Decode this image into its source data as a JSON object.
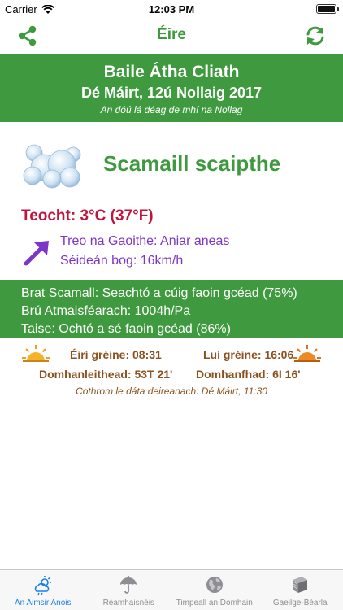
{
  "status_bar": {
    "carrier": "Carrier",
    "time": "12:03 PM"
  },
  "nav": {
    "title": "Éire",
    "share_icon": "share-icon",
    "refresh_icon": "refresh-icon"
  },
  "header": {
    "city": "Baile Átha Cliath",
    "date": "Dé Máirt, 12ú Nollaig 2017",
    "subtitle": "An dóú lá déag de mhí na Nollag"
  },
  "weather": {
    "condition": "Scamaill scaipthe",
    "temperature": "Teocht: 3°C (37°F)",
    "wind_direction": "Treo na Gaoithe: Aniar aneas",
    "wind_speed": "Séideán bog: 16km/h"
  },
  "details": {
    "cloud_cover": "Brat Scamall: Seachtó a cúig faoin gcéad (75%)",
    "pressure": "Brú Atmaisféarach: 1004h/Pa",
    "humidity": "Taise: Ochtó a sé faoin gcéad (86%)"
  },
  "sun": {
    "sunrise": "Éirí gréine: 08:31",
    "sunset": "Luí gréine: 16:06",
    "latitude": "Domhanleithead: 53T 21'",
    "longitude": "Domhanfhad: 6I 16'",
    "updated": "Cothrom le dáta deireanach: Dé Máirt, 11:30"
  },
  "tabs": [
    {
      "label": "An Aimsir Anois",
      "icon": "weather-now-icon",
      "active": true
    },
    {
      "label": "Réamhaisnéis",
      "icon": "umbrella-icon",
      "active": false
    },
    {
      "label": "Timpeall an Domhain",
      "icon": "globe-icon",
      "active": false
    },
    {
      "label": "Gaeilge-Béarla",
      "icon": "book-icon",
      "active": false
    }
  ],
  "colors": {
    "accent_green": "#3f9a3f",
    "temperature_red": "#c0143c",
    "wind_purple": "#7b35c8",
    "sun_brown": "#8a5220",
    "tab_active_blue": "#1a7ee8"
  }
}
